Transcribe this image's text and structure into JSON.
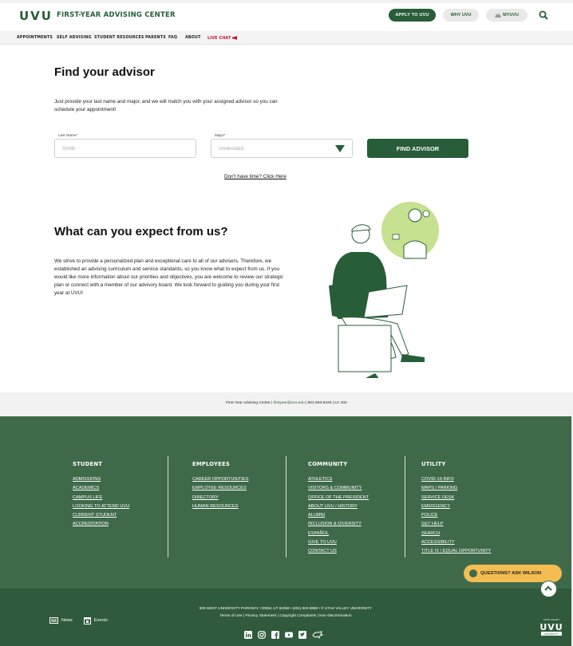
{
  "header": {
    "logo": "UVU",
    "title": "FIRST-YEAR ADVISING CENTER",
    "apply": "APPLY TO UVU",
    "why": "WHY UVU",
    "my": "MYUVU"
  },
  "nav": [
    "APPOINTMENTS",
    "SELF ADVISING",
    "STUDENT RESOURCES",
    "PARENTS",
    "FAQ",
    "ABOUT",
    "LIVE CHAT"
  ],
  "find": {
    "title": "Find your advisor",
    "intro": "Just provide your last name and major, and we will match you with your assigned advisor so you can schedule your appointment!",
    "last_name_label": "Last Name*",
    "last_name_placeholder": "Smith",
    "major_label": "Major*",
    "major_value": "Undecided",
    "button": "FIND ADVISOR",
    "no_time": "Don't have time? Click Here"
  },
  "expect": {
    "title": "What can you expect from us?",
    "text": "We strive to provide a personalized plan and exceptional care to all of our advisers. Therefore, we established an advising curriculum and service standards, so you know what to expect from us. If you would like more information about our priorities and objectives, you are welcome to review our strategic plan or connect with a member of our advisory board. We look forward to guiding you during your first year at UVU!"
  },
  "contact": {
    "prefix": "First-Year Advising Center | ",
    "email": "firstyear@uvu.edu",
    "suffix": " | 801-863-8425 | LC 402"
  },
  "footer": {
    "student": {
      "heading": "STUDENT",
      "links": [
        "ADMISSIONS",
        "ACADEMICS",
        "CAMPUS LIFE",
        "LOOKING TO ATTEND UVU",
        "CURRENT STUDENT",
        "ACCREDITATION"
      ]
    },
    "employees": {
      "heading": "EMPLOYEES",
      "links": [
        "CAREER OPPORTUNITIES",
        "EMPLOYEE RESOURCES",
        "DIRECTORY",
        "HUMAN RESOURCES"
      ]
    },
    "community": {
      "heading": "COMMUNITY",
      "links": [
        "ATHLETICS",
        "VISITORS & COMMUNITY",
        "OFFICE OF THE PRESIDENT",
        "ABOUT UVU / HISTORY",
        "ALUMNI",
        "INCLUSION & DIVERSITY",
        "ESPAÑOL",
        "GIVE TO UVU",
        "CONTACT US"
      ]
    },
    "utility": {
      "heading": "UTILITY",
      "links": [
        "COVID-19 INFO",
        "MAPS / PARKING",
        "SERVICE DESK",
        "EMERGENCY",
        "POLICE",
        "GET HELP",
        "SEARCH",
        "ACCESSIBILITY",
        "TITLE IX / EQUAL OPPORTUNITY"
      ]
    },
    "wilson": "QUESTIONS? ASK WILSON",
    "address": "800 WEST UNIVERSITY PARKWAY, OREM, UT 84058  •  (801) 863-8888  •  © UTAH VALLEY UNIVERSITY",
    "legal": "Terms of Use  |  Privacy Statement  |  Copyright Complaints  |  Non-Discrimination",
    "news": "News",
    "events": "Events"
  },
  "colors": {
    "brand": "#275d38",
    "footer": "#3f6a4a",
    "footer_bottom": "#2f5a3c",
    "accent": "#f4bd52",
    "live": "#c8102e"
  }
}
